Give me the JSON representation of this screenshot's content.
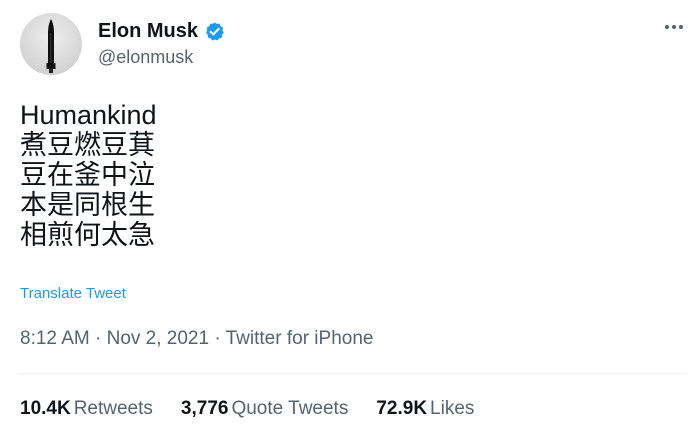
{
  "author": {
    "display_name": "Elon Musk",
    "handle": "@elonmusk",
    "verified": true,
    "verified_color": "#1d9bf0"
  },
  "tweet": {
    "lines": [
      "Humankind",
      "煮豆燃豆萁",
      "豆在釜中泣",
      "本是同根生",
      "相煎何太急"
    ],
    "translate_label": "Translate Tweet"
  },
  "meta": {
    "time": "8:12 AM",
    "separator": "·",
    "date": "Nov 2, 2021",
    "source": "Twitter for iPhone"
  },
  "stats": {
    "retweets_count": "10.4K",
    "retweets_label": "Retweets",
    "quotes_count": "3,776",
    "quotes_label": "Quote Tweets",
    "likes_count": "72.9K",
    "likes_label": "Likes"
  },
  "colors": {
    "text": "#0f1419",
    "secondary": "#536471",
    "link": "#1d9bf0",
    "divider": "#eff3f4"
  },
  "icons": {
    "verified": "verified-badge-icon",
    "more": "more-icon"
  }
}
